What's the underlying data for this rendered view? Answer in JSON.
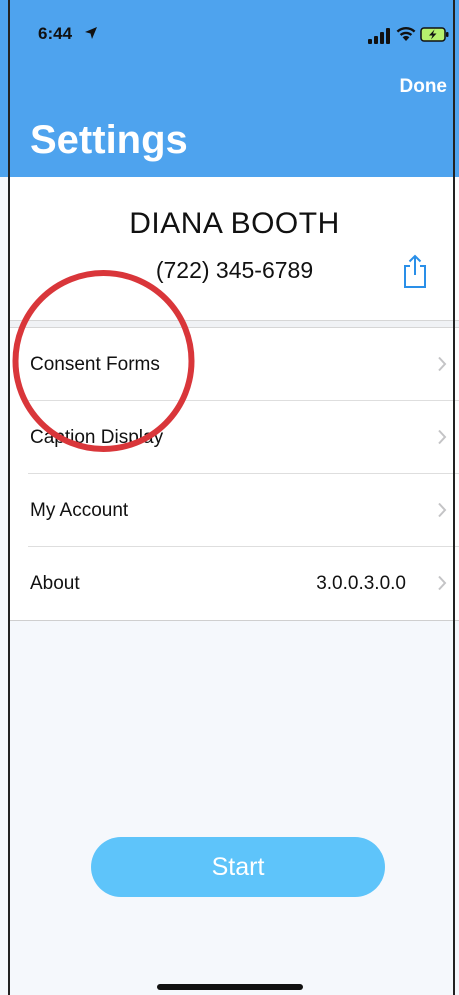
{
  "status_bar": {
    "time": "6:44"
  },
  "nav": {
    "done_label": "Done",
    "title": "Settings"
  },
  "profile": {
    "name": "DIANA BOOTH",
    "phone": "(722) 345-6789"
  },
  "menu": {
    "items": [
      {
        "label": "Consent Forms",
        "value": ""
      },
      {
        "label": "Caption Display",
        "value": ""
      },
      {
        "label": "My Account",
        "value": ""
      },
      {
        "label": "About",
        "value": "3.0.0.3.0.0"
      }
    ]
  },
  "start_button": {
    "label": "Start"
  },
  "colors": {
    "header": "#4ea3ee",
    "start_button": "#5ec4fa",
    "share_icon": "#2a8fe8",
    "annotation": "#d9363a"
  },
  "icons": [
    "location-arrow-icon",
    "signal-icon",
    "wifi-icon",
    "battery-charging-icon",
    "share-icon",
    "chevron-right-icon"
  ]
}
